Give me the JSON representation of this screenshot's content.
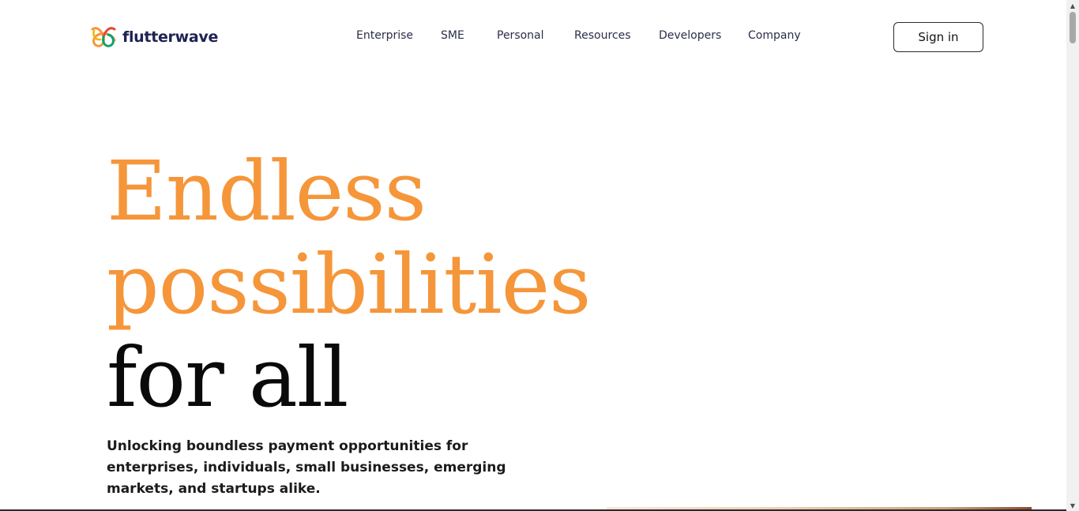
{
  "header": {
    "brand": "flutterwave",
    "nav": [
      "Enterprise",
      "SME",
      "Personal",
      "Resources",
      "Developers",
      "Company"
    ],
    "signin_label": "Sign in"
  },
  "hero": {
    "title_line1": "Endless",
    "title_line2": "possibilities",
    "title_line3": "for all",
    "subtitle": "Unlocking boundless payment opportunities for enterprises, individuals, small businesses, emerging markets, and startups alike."
  },
  "colors": {
    "accent_orange": "#f5963a",
    "brand_navy": "#1f2252",
    "text_dark": "#0a0a0a"
  },
  "icons": {
    "logo": "flutterwave-logo-icon",
    "scroll_up": "triangle-up-icon",
    "scroll_down": "triangle-down-icon"
  }
}
